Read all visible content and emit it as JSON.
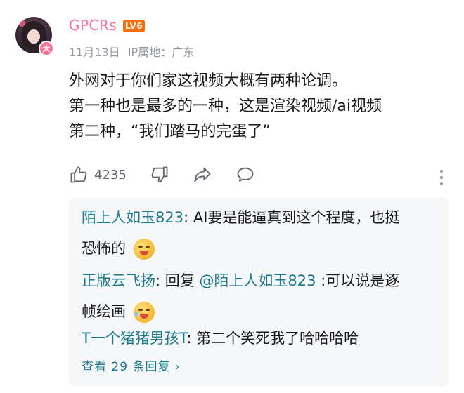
{
  "comment": {
    "username": "GPCRs",
    "level": "LV6",
    "avatar_badge": "大",
    "date": "11月13日",
    "ip_location": "IP属地：广东",
    "lines": [
      "外网对于你们家这视频大概有两种论调。",
      "第一种也是最多的一种，这是渲染视频/ai视频",
      "第二种，“我们踏马的完蛋了”"
    ]
  },
  "actions": {
    "like_count": "4235",
    "icons": [
      "thumbs-up-icon",
      "thumbs-down-icon",
      "share-icon",
      "comment-icon",
      "more-vertical-icon"
    ]
  },
  "replies": [
    {
      "name": "陌上人如玉823",
      "line1": ": AI要是能逼真到这个程度，也挺",
      "line2": "恐怖的",
      "emoji": "scared-face-emoji"
    },
    {
      "name": "正版云飞扬",
      "prefix": ": 回复 ",
      "mention": "@陌上人如玉823",
      "line1": " :可以说是逐",
      "line2": "帧绘画",
      "emoji": "laughing-tears-emoji"
    },
    {
      "name": "T一个猪猪男孩T",
      "line1": ": 第二个笑死我了哈哈哈哈"
    }
  ],
  "view_more": "查看 29 条回复 ›",
  "colors": {
    "username": "#fb7299",
    "level_badge": "#ff6c00",
    "reply_name": "#1a7a8c",
    "meta": "#9499a0",
    "reply_bg": "#f6f7f8"
  }
}
